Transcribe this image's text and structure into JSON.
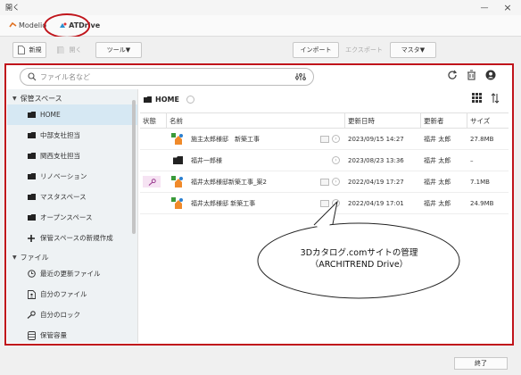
{
  "window": {
    "title": "開く",
    "minimize": "—",
    "close": "×"
  },
  "tabs": [
    {
      "label": "Modelio"
    },
    {
      "label": "ATDrive"
    }
  ],
  "toolbar": {
    "new_label": "新規",
    "open_label": "開く",
    "tools_label": "ツール▼",
    "import_label": "インポート",
    "export_label": "エクスポート",
    "master_label": "マスタ▼"
  },
  "search": {
    "placeholder": "ファイル名など"
  },
  "sidebar": {
    "storage_header": "保管スペース",
    "storage_items": [
      {
        "label": "HOME"
      },
      {
        "label": "中部支社担当"
      },
      {
        "label": "関西支社担当"
      },
      {
        "label": "リノベーション"
      },
      {
        "label": "マスタスペース"
      },
      {
        "label": "オープンスペース"
      },
      {
        "label": "保管スペースの新規作成"
      }
    ],
    "file_header": "ファイル",
    "file_items": [
      {
        "label": "最近の更新ファイル"
      },
      {
        "label": "自分のファイル"
      },
      {
        "label": "自分のロック"
      },
      {
        "label": "保管容量"
      }
    ]
  },
  "breadcrumb": {
    "label": "HOME"
  },
  "table": {
    "columns": [
      "状態",
      "名前",
      "更新日時",
      "更新者",
      "サイズ"
    ],
    "rows": [
      {
        "name": "施主太郎様邸　新築工事",
        "date": "2023/09/15 14:27",
        "user": "福井 太郎",
        "size": "27.8MB"
      },
      {
        "name": "福井一郎様",
        "date": "2023/08/23 13:36",
        "user": "福井 太郎",
        "size": "–"
      },
      {
        "name": "福井太郎様邸新築工事_案2",
        "date": "2022/04/19 17:27",
        "user": "福井 太郎",
        "size": "7.1MB"
      },
      {
        "name": "福井太郎様邸 新築工事",
        "date": "2022/04/19 17:01",
        "user": "福井 太郎",
        "size": "24.9MB"
      }
    ]
  },
  "callout": {
    "line1": "3Dカタログ.comサイトの管理",
    "line2": "（ARCHITREND Drive）"
  },
  "footer": {
    "close_label": "終了"
  },
  "colors": {
    "highlight": "#c0141b",
    "sidebar_bg": "#eef2f4",
    "selected": "#d6e8f3"
  }
}
